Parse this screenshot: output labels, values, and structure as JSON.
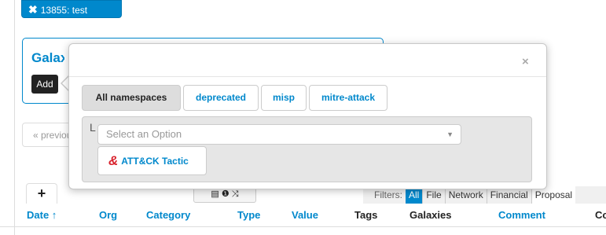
{
  "tag_chip": {
    "icon": "close-icon",
    "label": "13855: test"
  },
  "galaxy": {
    "title": "Galaxies",
    "add_label": "Add"
  },
  "pagination": {
    "prev_label": "« previous"
  },
  "tabs": {
    "plus_label": "+"
  },
  "tools": {
    "icons": [
      "list-icon",
      "info-icon",
      "shuffle-icon"
    ],
    "glyphs": "▤ ❶ ⤨"
  },
  "filters": {
    "label": "Filters:",
    "items": [
      "All",
      "File",
      "Network",
      "Financial",
      "Proposal"
    ],
    "active": "All"
  },
  "columns": [
    "Date ↑",
    "Org",
    "Category",
    "Type",
    "Value",
    "Tags",
    "Galaxies",
    "Comment",
    "Co"
  ],
  "modal": {
    "close_label": "×",
    "namespaces": [
      "All namespaces",
      "deprecated",
      "misp",
      "mitre-attack"
    ],
    "active_namespace": "All namespaces",
    "picker_prefix": "L",
    "select_placeholder": "Select an Option",
    "option": {
      "icon": "ampersand-icon",
      "glyph": "&",
      "label": "ATT&CK Tactic"
    }
  },
  "colors": {
    "accent": "#0088cc",
    "option_icon": "#d9232e"
  }
}
